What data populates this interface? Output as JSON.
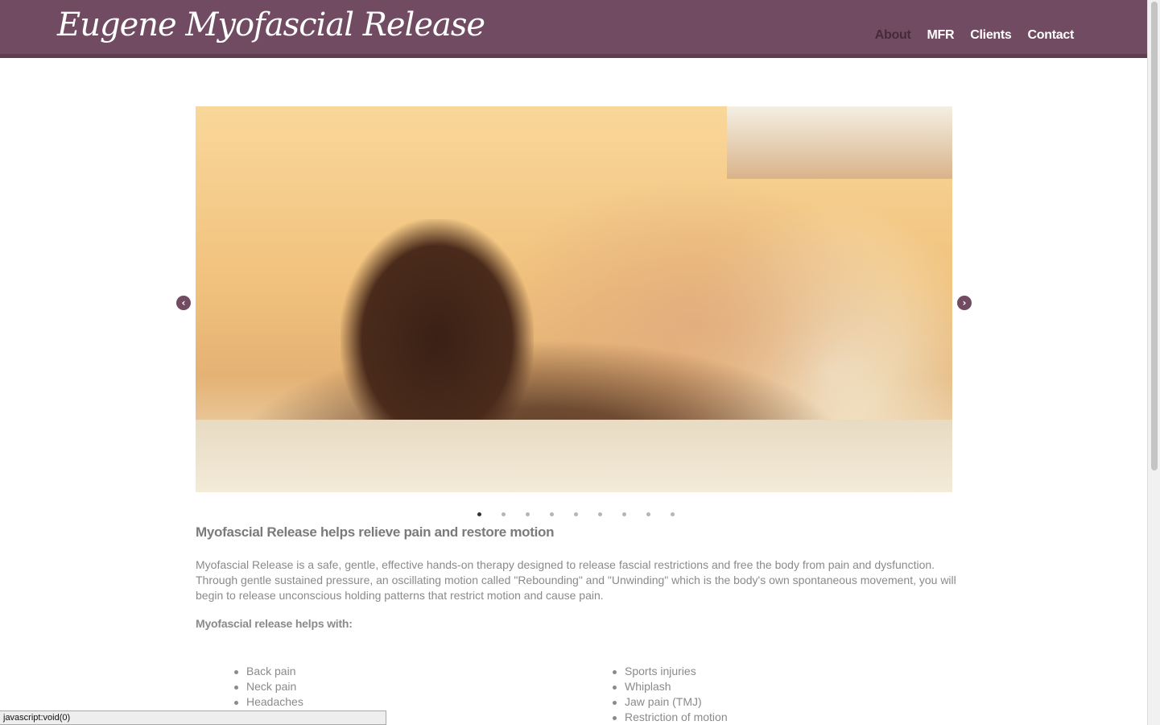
{
  "header": {
    "brand": "Eugene Myofascial Release",
    "nav": [
      {
        "label": "About",
        "active": true
      },
      {
        "label": "MFR",
        "active": false
      },
      {
        "label": "Clients",
        "active": false
      },
      {
        "label": "Contact",
        "active": false
      }
    ]
  },
  "carousel": {
    "prev_icon": "chevron-left-circle-icon",
    "next_icon": "chevron-right-circle-icon",
    "slide_count": 9,
    "active_index": 0
  },
  "content": {
    "headline": "Myofascial Release helps relieve pain and restore motion",
    "intro": "Myofascial Release is a safe, gentle, effective hands-on therapy designed to release fascial restrictions and free the body from pain and dysfunction. Through gentle sustained pressure, an oscillating motion called \"Rebounding\" and \"Unwinding\" which is the body's own spontaneous movement, you will begin to release unconscious holding patterns that restrict motion and cause pain.",
    "helps_heading": "Myofascial release helps with:",
    "list_left": [
      "Back pain",
      "Neck pain",
      "Headaches"
    ],
    "list_right": [
      "Sports injuries",
      "Whiplash",
      "Jaw pain (TMJ)",
      "Restriction of motion"
    ]
  },
  "status_bar": {
    "text": "javascript:void(0)"
  },
  "colors": {
    "header_bg": "#704b62",
    "nav_active": "#452a3b",
    "text": "#8a8a8a"
  }
}
